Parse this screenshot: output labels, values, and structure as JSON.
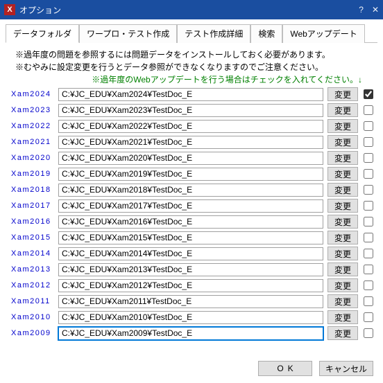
{
  "title": "オプション",
  "tabs": [
    "データフォルダ",
    "ワープロ・テスト作成",
    "テスト作成詳細",
    "検索",
    "Webアップデート"
  ],
  "activeTab": 0,
  "notes": {
    "line1": "※過年度の問題を参照するには問題データをインストールしておく必要があります。",
    "line2": "※むやみに設定変更を行うとデータ参照ができなくなりますのでご注意ください。",
    "hint": "※過年度のWebアップデートを行う場合はチェックを入れてください。↓"
  },
  "changeLabel": "変更",
  "rows": [
    {
      "year": "Xam2024",
      "path": "C:¥JC_EDU¥Xam2024¥TestDoc_E",
      "checked": true
    },
    {
      "year": "Xam2023",
      "path": "C:¥JC_EDU¥Xam2023¥TestDoc_E",
      "checked": false
    },
    {
      "year": "Xam2022",
      "path": "C:¥JC_EDU¥Xam2022¥TestDoc_E",
      "checked": false
    },
    {
      "year": "Xam2021",
      "path": "C:¥JC_EDU¥Xam2021¥TestDoc_E",
      "checked": false
    },
    {
      "year": "Xam2020",
      "path": "C:¥JC_EDU¥Xam2020¥TestDoc_E",
      "checked": false
    },
    {
      "year": "Xam2019",
      "path": "C:¥JC_EDU¥Xam2019¥TestDoc_E",
      "checked": false
    },
    {
      "year": "Xam2018",
      "path": "C:¥JC_EDU¥Xam2018¥TestDoc_E",
      "checked": false
    },
    {
      "year": "Xam2017",
      "path": "C:¥JC_EDU¥Xam2017¥TestDoc_E",
      "checked": false
    },
    {
      "year": "Xam2016",
      "path": "C:¥JC_EDU¥Xam2016¥TestDoc_E",
      "checked": false
    },
    {
      "year": "Xam2015",
      "path": "C:¥JC_EDU¥Xam2015¥TestDoc_E",
      "checked": false
    },
    {
      "year": "Xam2014",
      "path": "C:¥JC_EDU¥Xam2014¥TestDoc_E",
      "checked": false
    },
    {
      "year": "Xam2013",
      "path": "C:¥JC_EDU¥Xam2013¥TestDoc_E",
      "checked": false
    },
    {
      "year": "Xam2012",
      "path": "C:¥JC_EDU¥Xam2012¥TestDoc_E",
      "checked": false
    },
    {
      "year": "Xam2011",
      "path": "C:¥JC_EDU¥Xam2011¥TestDoc_E",
      "checked": false
    },
    {
      "year": "Xam2010",
      "path": "C:¥JC_EDU¥Xam2010¥TestDoc_E",
      "checked": false
    },
    {
      "year": "Xam2009",
      "path": "C:¥JC_EDU¥Xam2009¥TestDoc_E",
      "checked": false,
      "focused": true
    }
  ],
  "footer": {
    "ok": "OK",
    "cancel": "キャンセル"
  }
}
